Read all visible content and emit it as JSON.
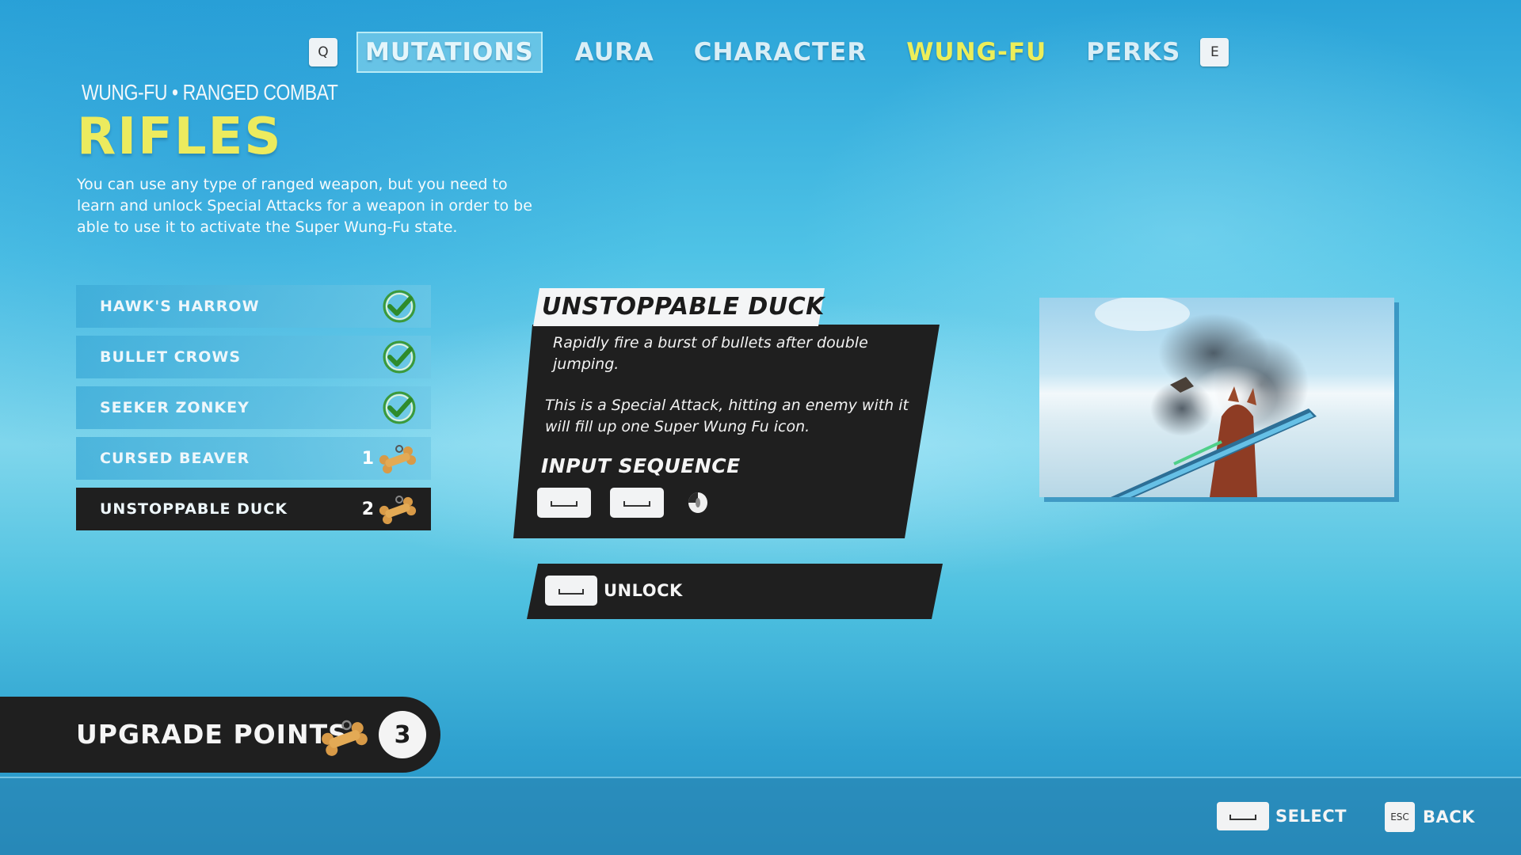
{
  "tabs": {
    "prev_key": "Q",
    "next_key": "E",
    "items": [
      {
        "label": "MUTATIONS"
      },
      {
        "label": "AURA"
      },
      {
        "label": "CHARACTER"
      },
      {
        "label": "WUNG-FU"
      },
      {
        "label": "PERKS"
      }
    ],
    "active": "MUTATIONS",
    "highlighted": "WUNG-FU"
  },
  "header": {
    "breadcrumb": "WUNG-FU • RANGED COMBAT",
    "title": "RIFLES",
    "description": "You can use any type of ranged weapon, but you need to learn and unlock Special Attacks for a weapon in order to be able to use it to activate the Super Wung-Fu state."
  },
  "attacks": [
    {
      "label": "HAWK'S HARROW",
      "status": "unlocked",
      "icon": "check-icon"
    },
    {
      "label": "BULLET CROWS",
      "status": "unlocked",
      "icon": "check-icon"
    },
    {
      "label": "SEEKER ZONKEY",
      "status": "unlocked",
      "icon": "check-icon"
    },
    {
      "label": "CURSED BEAVER",
      "status": "locked",
      "cost": "1",
      "icon": "bone-icon"
    },
    {
      "label": "UNSTOPPABLE DUCK",
      "status": "locked",
      "cost": "2",
      "icon": "bone-icon",
      "selected": true
    }
  ],
  "detail": {
    "title": "UNSTOPPABLE DUCK",
    "description_1": "Rapidly fire a burst of bullets after double jumping.",
    "description_2": "This is a Special Attack, hitting an enemy with it will fill up one Super Wung Fu icon.",
    "input_title": "INPUT SEQUENCE",
    "input_sequence": [
      "space-key-icon",
      "space-key-icon",
      "mouse-left-click-icon"
    ],
    "unlock_label": "UNLOCK"
  },
  "upgrade_points": {
    "label": "UPGRADE POINTS",
    "value": "3",
    "icon": "bone-icon"
  },
  "hints": {
    "select_label": "SELECT",
    "back_key": "ESC",
    "back_label": "BACK"
  },
  "colors": {
    "highlight_yellow": "#ECEB5E",
    "panel_dark": "#1F1F1F",
    "check_green": "#3C9A3A"
  }
}
